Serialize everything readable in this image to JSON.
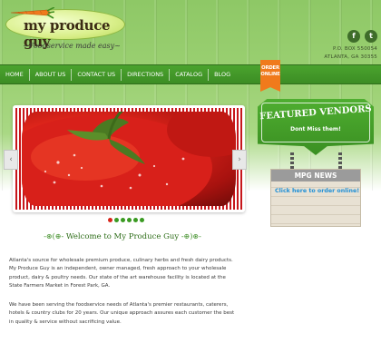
{
  "brand": {
    "name": "my produce guy",
    "tagline": "~Foodservice made easy~"
  },
  "social": {
    "facebook": "f",
    "twitter": "t"
  },
  "address": {
    "line1": "P.O. BOX 550054",
    "line2": "ATLANTA, GA 30355"
  },
  "nav": {
    "items": [
      "HOME",
      "ABOUT US",
      "CONTACT US",
      "DIRECTIONS",
      "CATALOG",
      "BLOG"
    ],
    "order_online": "ORDER ONLINE"
  },
  "slider": {
    "prev": "‹",
    "next": "›",
    "dots_total": 6,
    "active_dot": 0
  },
  "welcome": {
    "flourish_left": "-⊛(⊕-",
    "title": "Welcome to My Produce Guy",
    "flourish_right": "-⊕)⊛-"
  },
  "body": {
    "paragraph1": "Atlanta's source for wholesale premium produce, culinary herbs and fresh dairy products. My Produce Guy is an independent, owner managed, fresh approach to your wholesale product, dairy & poultry needs. Our state of the art warehouse facility is located at the State Farmers Market in Forest Park, GA.",
    "paragraph2": "We have been serving the foodservice needs of Atlanta's premier restaurants, caterers, hotels & country clubs for 20 years. Our unique approach assures each customer the best in quality & service without sacrificing value."
  },
  "sidebar": {
    "vendors_title": "FEATURED VENDORS",
    "vendors_subtitle": "Dont Miss them!",
    "news_title": "MPG NEWS",
    "news_link": "Click here to order online!"
  },
  "colors": {
    "nav_green": "#3c8d24",
    "order_orange": "#f07a1c",
    "tomato_red": "#e1261b",
    "link_blue": "#1f8fd6"
  }
}
